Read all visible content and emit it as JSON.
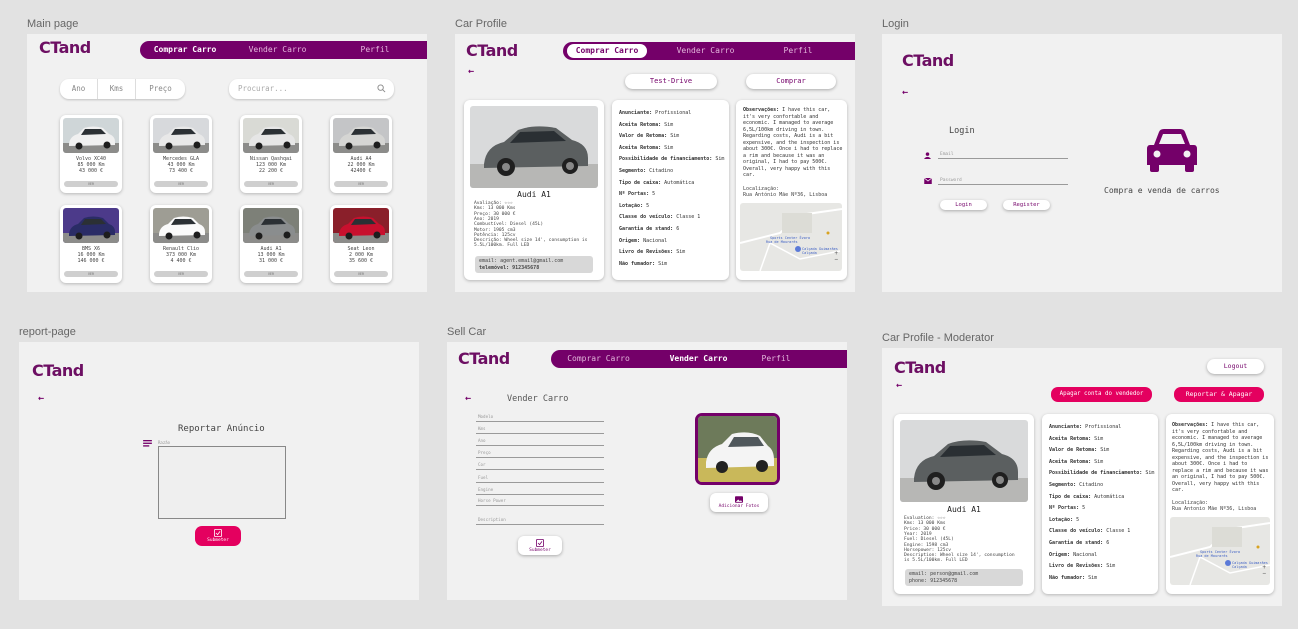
{
  "frames": {
    "main": "Main page",
    "profile": "Car Profile",
    "login": "Login",
    "report": "report-page",
    "sell": "Sell Car",
    "moderator": "Car Profile - Moderator"
  },
  "brand": "CTand",
  "nav": {
    "buy": "Comprar Carro",
    "sell": "Vender Carro",
    "profile": "Perfil"
  },
  "main": {
    "filters": [
      "Ano",
      "Kms",
      "Preço"
    ],
    "search_placeholder": "Procurar...",
    "view_label": "VER",
    "cars": [
      {
        "name": "Volvo XC40",
        "km": "85 000 Km",
        "price": "43 000 €"
      },
      {
        "name": "Mercedes GLA",
        "km": "43 000 Km",
        "price": "73 400 €"
      },
      {
        "name": "Nissan Qashqai",
        "km": "123 000 Km",
        "price": "22 200 €"
      },
      {
        "name": "Audi A4",
        "km": "22 000 Km",
        "price": "42400 €"
      },
      {
        "name": "BMS X6",
        "km": "16 000 Km",
        "price": "146 000 €"
      },
      {
        "name": "Renault Clio",
        "km": "373 000 Km",
        "price": "4 400 €"
      },
      {
        "name": "Audi A1",
        "km": "13 000 Km",
        "price": "31 000 €"
      },
      {
        "name": "Seat Leon",
        "km": "2 000 Km",
        "price": "35 600 €"
      }
    ]
  },
  "profile": {
    "test_drive": "Test-Drive",
    "buy": "Comprar",
    "car_name": "Audi A1",
    "specs": [
      "Avaliação: ☆☆☆",
      "Kms: 13 000 Kms",
      "Preço: 30 000 €",
      "Ano: 2019",
      "Combustível: Diesel (45L)",
      "Motor: 1905 cm3",
      "Potência: 125cv",
      "Descrição: Wheel size 14', consumption is",
      "5.5L/100km. Full LED"
    ],
    "contact": [
      "email: agent.email@gmail.com",
      "telemóvel: 912345678"
    ],
    "details": [
      [
        "Anunciante:",
        "Profissional"
      ],
      [
        "Aceita Retoma:",
        "Sim"
      ],
      [
        "Valor de Retoma:",
        "Sim"
      ],
      [
        "Aceita Retoma:",
        "Sim"
      ],
      [
        "Possibilidade de financiamento:",
        "Sim"
      ],
      [
        "Segmento:",
        "Citadino"
      ],
      [
        "Tipo de caixa:",
        "Automática"
      ],
      [
        "Nº Portas:",
        "5"
      ],
      [
        "Lotação:",
        "5"
      ],
      [
        "Classe do veículo:",
        "Classe 1"
      ],
      [
        "Garantia de stand:",
        "6"
      ],
      [
        "Origem:",
        "Nacional"
      ],
      [
        "Livro de Revisões:",
        "Sim"
      ],
      [
        "Não fumador:",
        "Sim"
      ]
    ],
    "obs_title": "Observações:",
    "obs": "I have this car, it's very confortable and economic. I managed to average 6,5L/100km driving in town. Regarding costs, Audi is a bit expensive, and the inspection is about 300€. Once i had to replace a rim and because it was an original, I had to pay 500€. Overall, very happy with this car.",
    "loc_title": "Localização:",
    "loc": "Rua António Mãe Nº36, Lisboa",
    "map": [
      "Sports Center Évora",
      "Rua de Mourarés",
      "Calçada Guimarães",
      "Calçada"
    ]
  },
  "login": {
    "email": "Email",
    "password": "Password",
    "login": "Login",
    "register": "Register",
    "title": "Login",
    "tagline": "Compra e venda de carros"
  },
  "report": {
    "title": "Reportar Anúncio",
    "hint": "Razão",
    "submit": "Submeter"
  },
  "sell": {
    "title": "Vender Carro",
    "fields": [
      "Modelo",
      "Kms",
      "Ano",
      "Preço",
      "Cor",
      "Fuel",
      "Engine",
      "Horse Power",
      "Description"
    ],
    "add_photos": "Adicionar Fotos",
    "submit": "Submeter"
  },
  "moderator": {
    "logout": "Logout",
    "delete_seller": "Apagar conta do vendedor",
    "report_delete": "Reportar & Apagar",
    "car_name": "Audi A1",
    "specs": [
      "Evaluation: ☆☆☆",
      "Kms: 13 000 Kms",
      "Price: 30 000 €",
      "Year: 2019",
      "Fuel: Diesel (45L)",
      "Engine: 1598 cm3",
      "Horsepower: 125cv",
      "Description: Wheel size 14', consumption",
      "is 5.5L/100km. Full LED"
    ],
    "contact": [
      "email: person@gmail.com",
      "phone: 912345678"
    ],
    "details": [
      [
        "Anunciante:",
        "Profissional"
      ],
      [
        "Aceita Retoma:",
        "Sim"
      ],
      [
        "Valor de Retoma:",
        "Sim"
      ],
      [
        "Aceita Retoma:",
        "Sim"
      ],
      [
        "Possibilidade de financiamento:",
        "Sim"
      ],
      [
        "Segmento:",
        "Citadino"
      ],
      [
        "Tipo de caixa:",
        "Automática"
      ],
      [
        "Nº Portas:",
        "5"
      ],
      [
        "Lotação:",
        "5"
      ],
      [
        "Classe do veículo:",
        "Classe 1"
      ],
      [
        "Garantia de stand:",
        "6"
      ],
      [
        "Origem:",
        "Nacional"
      ],
      [
        "Livro de Revisões:",
        "Sim"
      ],
      [
        "Não fumador:",
        "Sim"
      ]
    ],
    "obs_title": "Observações:",
    "obs": "I have this car, it's very confortable and economic. I managed to average 6,5L/100km driving in town. Regarding costs, Audi is a bit expensive, and the inspection is about 300€. Once i had to replace a rim and because it was an original, I had to pay 500€. Overall, very happy with this car.",
    "loc_title": "Localização:",
    "loc": "Rua Antonio Mãe Nº36, Lisboa"
  },
  "colors": {
    "brand": "#740069",
    "accent": "#e4005f",
    "frame": "#f1f1f1"
  }
}
